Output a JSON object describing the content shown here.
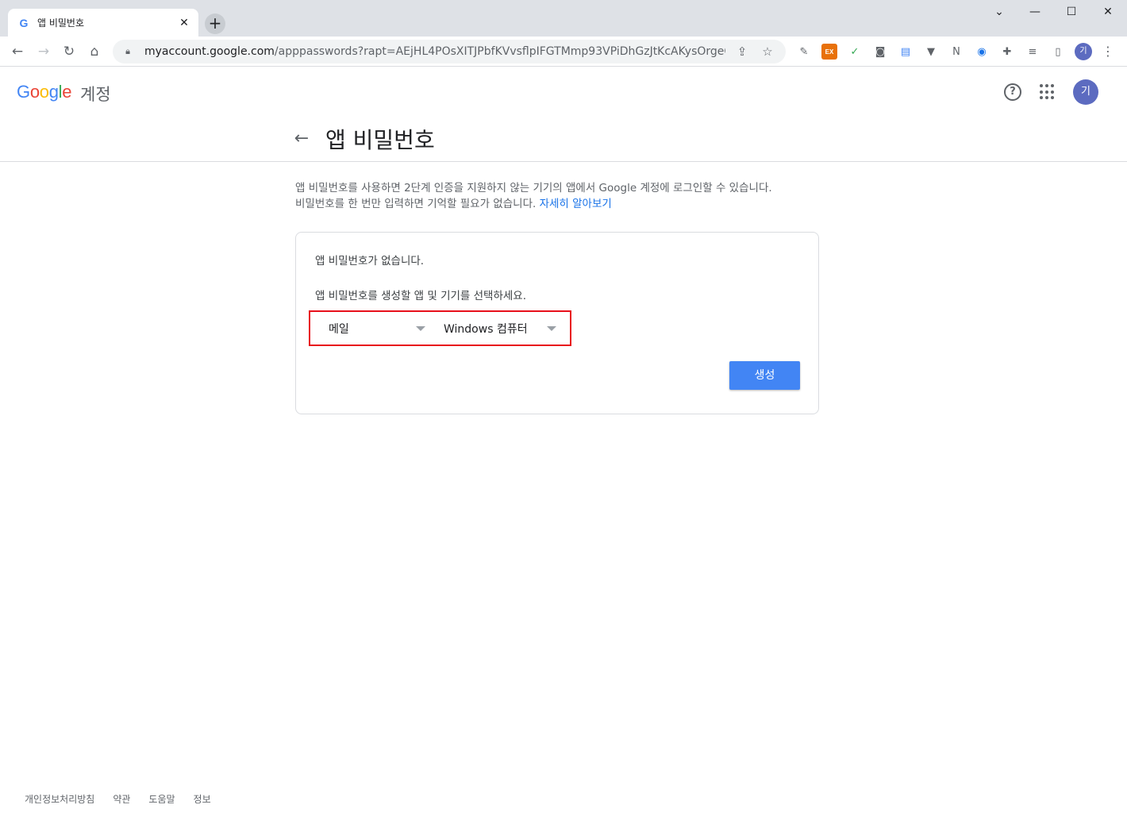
{
  "browser": {
    "tab_title": "앱 비밀번호",
    "tab_favicon": "G",
    "url_host": "myaccount.google.com",
    "url_path": "/apppasswords?rapt=AEjHL4POsXITJPbfKVvsflpIFGTMmp93VPiDhGzJtKcAKysOrgeC2tb60tXiV...",
    "profile_initial": "기",
    "extensions": [
      {
        "name": "eyedropper-icon",
        "glyph": "✎"
      },
      {
        "name": "ex-extension-icon",
        "glyph": "EX",
        "color": "#e8710a"
      },
      {
        "name": "shield-extension-icon",
        "glyph": "✓",
        "color": "#34a853"
      },
      {
        "name": "camera-icon",
        "glyph": "◙"
      },
      {
        "name": "keyboard-extension-icon",
        "glyph": "▤",
        "color": "#4285f4"
      },
      {
        "name": "vue-extension-icon",
        "glyph": "▼"
      },
      {
        "name": "notion-extension-icon",
        "glyph": "N"
      },
      {
        "name": "record-extension-icon",
        "glyph": "◉",
        "color": "#1a73e8"
      },
      {
        "name": "puzzle-icon",
        "glyph": "✚"
      },
      {
        "name": "media-control-icon",
        "glyph": "≡"
      },
      {
        "name": "side-panel-icon",
        "glyph": "▯"
      }
    ]
  },
  "header": {
    "logo_letters": [
      "G",
      "o",
      "o",
      "g",
      "l",
      "e"
    ],
    "logo_suffix": "계정",
    "avatar_initial": "기"
  },
  "page": {
    "title": "앱 비밀번호",
    "description_line1": "앱 비밀번호를 사용하면 2단계 인증을 지원하지 않는 기기의 앱에서 Google 계정에 로그인할 수 있습니다.",
    "description_line2": "비밀번호를 한 번만 입력하면 기억할 필요가 없습니다.",
    "learn_more": "자세히 알아보기"
  },
  "card": {
    "empty_message": "앱 비밀번호가 없습니다.",
    "instruction": "앱 비밀번호를 생성할 앱 및 기기를 선택하세요.",
    "app_select": "메일",
    "device_select": "Windows 컴퓨터",
    "generate_label": "생성"
  },
  "footer": {
    "links": [
      "개인정보처리방침",
      "약관",
      "도움말",
      "정보"
    ]
  },
  "colors": {
    "accent": "#4285f4",
    "link": "#1a73e8",
    "highlight_box": "#e8101b"
  }
}
